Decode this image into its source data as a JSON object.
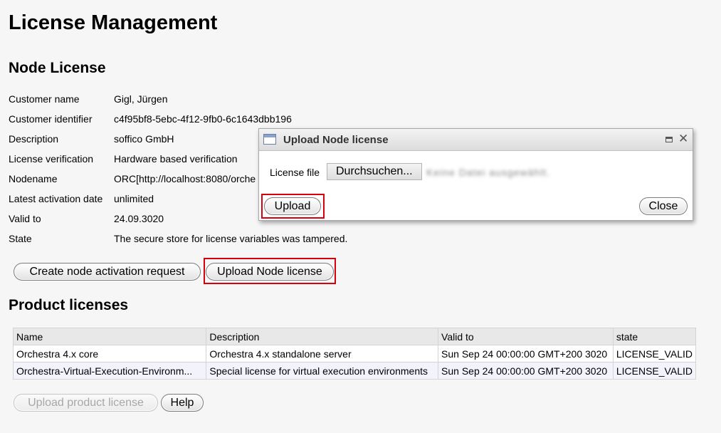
{
  "page_title": "License Management",
  "node_license": {
    "heading": "Node License",
    "rows": [
      {
        "label": "Customer name",
        "value": "Gigl, Jürgen"
      },
      {
        "label": "Customer identifier",
        "value": "c4f95bf8-5ebc-4f12-9fb0-6c1643dbb196"
      },
      {
        "label": "Description",
        "value": "soffico GmbH"
      },
      {
        "label": "License verification",
        "value": "Hardware based verification"
      },
      {
        "label": "Nodename",
        "value": "ORC[http://localhost:8080/orche"
      },
      {
        "label": "Latest activation date",
        "value": "unlimited"
      },
      {
        "label": "Valid to",
        "value": "24.09.3020"
      },
      {
        "label": "State",
        "value": "The secure store for license variables was tampered."
      }
    ],
    "buttons": {
      "create_request": "Create node activation request",
      "upload_node_license": "Upload Node license"
    }
  },
  "product_licenses": {
    "heading": "Product licenses",
    "columns": [
      "Name",
      "Description",
      "Valid to",
      "state"
    ],
    "rows": [
      [
        "Orchestra 4.x core",
        "Orchestra 4.x standalone server",
        "Sun Sep 24 00:00:00 GMT+200 3020",
        "LICENSE_VALID"
      ],
      [
        "Orchestra-Virtual-Execution-Environm...",
        "Special license for virtual execution environments",
        "Sun Sep 24 00:00:00 GMT+200 3020",
        "LICENSE_VALID"
      ]
    ],
    "buttons": {
      "upload_product_license": "Upload product license",
      "help": "Help"
    }
  },
  "dialog": {
    "title": "Upload Node license",
    "file_label": "License file",
    "browse_button": "Durchsuchen...",
    "file_status": "Keine Datei ausgewählt.",
    "upload_button": "Upload",
    "close_button": "Close"
  },
  "colors": {
    "highlight": "#d9000d",
    "background": "#f6f6f6"
  }
}
